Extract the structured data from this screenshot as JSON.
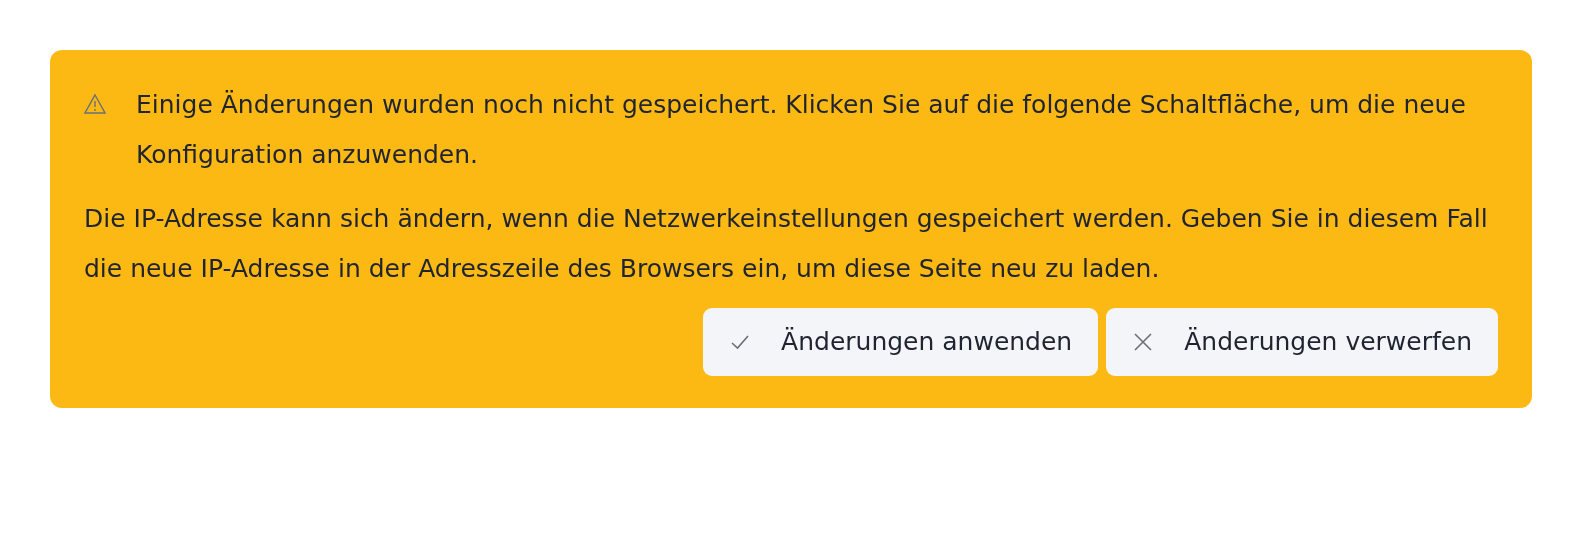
{
  "alert": {
    "messages": [
      "Einige Änderungen wurden noch nicht gespeichert. Klicken Sie auf die folgende Schaltfläche, um die neue Konfiguration anzuwenden.",
      "Die IP-Adresse kann sich ändern, wenn die Netzwerkeinstellungen gespeichert werden. Geben Sie in diesem Fall die neue IP-Adresse in der Adresszeile des Browsers ein, um diese Seite neu zu laden."
    ],
    "buttons": [
      {
        "label": "Änderungen anwenden",
        "kind": "apply"
      },
      {
        "label": "Änderungen verwerfen",
        "kind": "discard"
      }
    ]
  }
}
